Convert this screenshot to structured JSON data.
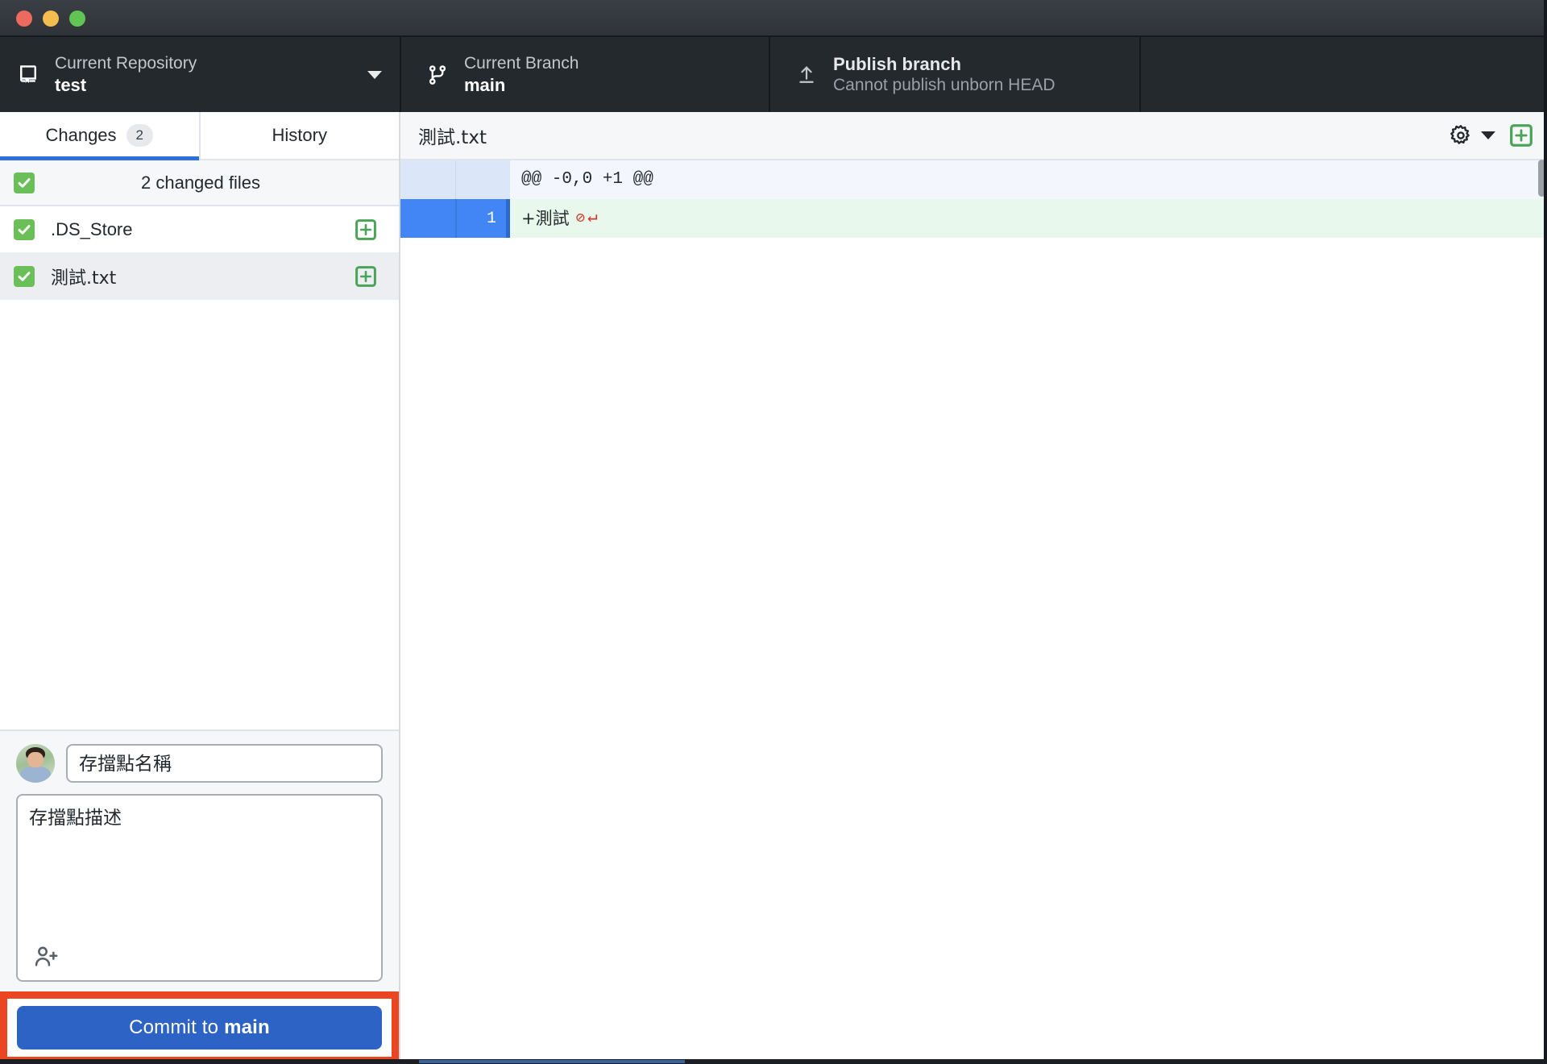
{
  "window": {
    "traffic_lights": [
      "close",
      "minimize",
      "zoom"
    ]
  },
  "toolbar": {
    "repository": {
      "icon": "repo-icon",
      "label": "Current Repository",
      "value": "test",
      "caret": "chevron-down-icon"
    },
    "branch": {
      "icon": "git-branch-icon",
      "label": "Current Branch",
      "value": "main"
    },
    "publish": {
      "icon": "upload-icon",
      "label": "Publish branch",
      "sublabel": "Cannot publish unborn HEAD"
    }
  },
  "sidebar": {
    "tabs": [
      {
        "label": "Changes",
        "badge": "2",
        "active": true
      },
      {
        "label": "History",
        "badge": "",
        "active": false
      }
    ],
    "changed_header": {
      "checked": true,
      "label": "2 changed files"
    },
    "files": [
      {
        "name": ".DS_Store",
        "checked": true,
        "status": "added",
        "selected": false
      },
      {
        "name": "測試.txt",
        "checked": true,
        "status": "added",
        "selected": true
      }
    ]
  },
  "commit": {
    "summary_placeholder": "存擋點名稱",
    "summary_value": "",
    "description_placeholder": "存擋點描述",
    "description_value": "",
    "coauthor_icon": "add-person-icon",
    "button_prefix": "Commit to ",
    "button_branch": "main",
    "highlight_color": "#ec4521"
  },
  "diff": {
    "file_name": "測試.txt",
    "settings_icon": "gear-icon",
    "settings_caret": "chevron-down-icon",
    "expand_icon": "plus-box-icon",
    "lines": [
      {
        "type": "hunk",
        "old": "",
        "new": "",
        "text": "@@ -0,0 +1 @@"
      },
      {
        "type": "add",
        "old": "",
        "new": "1",
        "text": "+測試",
        "no_newline": true,
        "crlf": true
      }
    ]
  },
  "colors": {
    "toolbar_bg": "#24292e",
    "accent_blue": "#2e6fe0",
    "commit_button": "#2c63c5",
    "added_green": "#6bbf59",
    "diff_add_bg": "#e8f8ec",
    "diff_hunk_bg": "#f3f7fd",
    "gutter_blue": "#4285f4",
    "highlight_red": "#ec4521"
  }
}
